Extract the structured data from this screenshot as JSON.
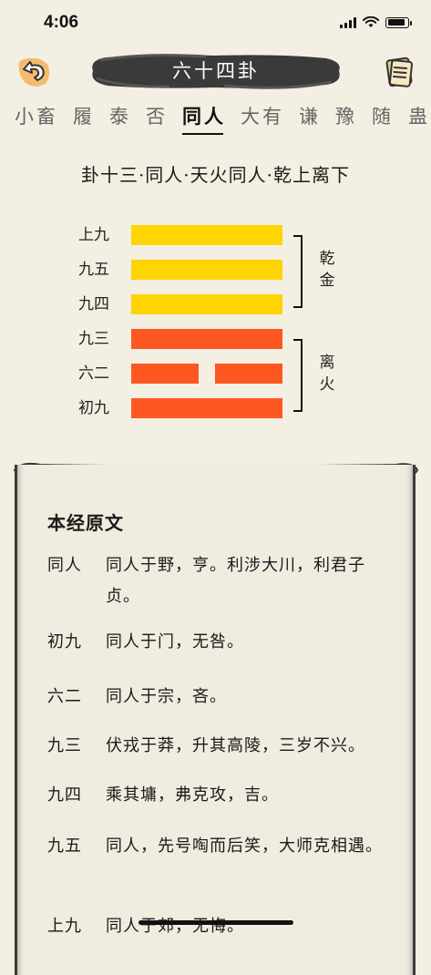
{
  "status": {
    "time": "4:06"
  },
  "header": {
    "title": "六十四卦",
    "back_icon": "back-arrow-icon",
    "notes_icon": "notes-icon"
  },
  "tabs": [
    {
      "label": "小畜",
      "active": false
    },
    {
      "label": "履",
      "active": false
    },
    {
      "label": "泰",
      "active": false
    },
    {
      "label": "否",
      "active": false
    },
    {
      "label": "同人",
      "active": true
    },
    {
      "label": "大有",
      "active": false
    },
    {
      "label": "谦",
      "active": false
    },
    {
      "label": "豫",
      "active": false
    },
    {
      "label": "随",
      "active": false
    },
    {
      "label": "蛊",
      "active": false
    }
  ],
  "subtitle": "卦十三·同人·天火同人·乾上离下",
  "hexagram": {
    "lines": [
      {
        "label": "上九",
        "type": "yang",
        "trigram": "upper"
      },
      {
        "label": "九五",
        "type": "yang",
        "trigram": "upper"
      },
      {
        "label": "九四",
        "type": "yang",
        "trigram": "upper"
      },
      {
        "label": "九三",
        "type": "yang",
        "trigram": "lower"
      },
      {
        "label": "六二",
        "type": "yin",
        "trigram": "lower"
      },
      {
        "label": "初九",
        "type": "yang",
        "trigram": "lower"
      }
    ],
    "upper_trigram": "乾金",
    "lower_trigram": "离火",
    "colors": {
      "upper": "#ffd400",
      "lower": "#ff5722"
    }
  },
  "text": {
    "heading": "本经原文",
    "entries": [
      {
        "key": "同人",
        "value": "同人于野，亨。利涉大川，利君子贞。"
      },
      {
        "key": "初九",
        "value": "同人于门，无咎。"
      },
      {
        "key": "六二",
        "value": "同人于宗，吝。"
      },
      {
        "key": "九三",
        "value": "伏戎于莽，升其高陵，三岁不兴。"
      },
      {
        "key": "九四",
        "value": "乘其墉，弗克攻，吉。"
      },
      {
        "key": "九五",
        "value": "同人，先号啕而后笑，大师克相遇。"
      },
      {
        "key": "上九",
        "value": "同人于郊，无悔。"
      }
    ]
  }
}
